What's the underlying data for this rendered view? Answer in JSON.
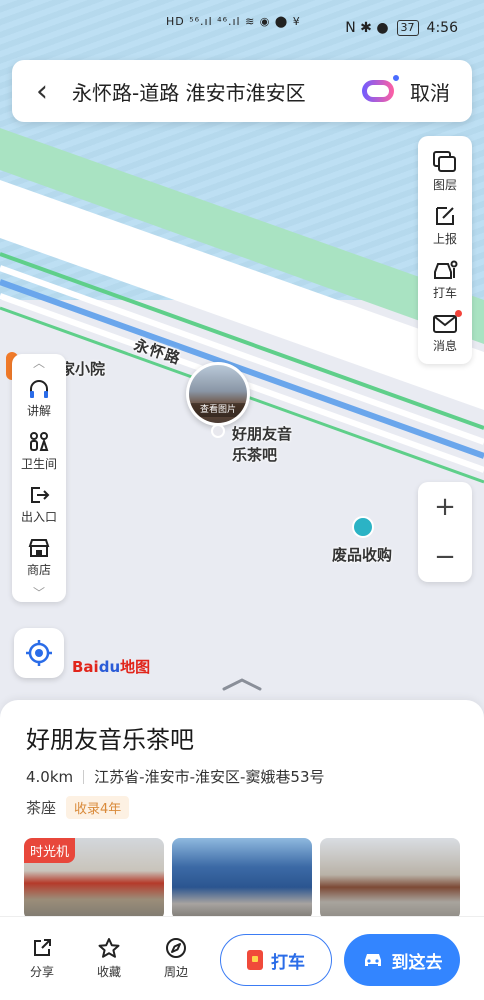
{
  "status_bar": {
    "icons_text": "HD ⁵⁶.ıl ⁴⁶.ıl ≋ ◉ ⬤ ¥",
    "right_icons": "N ✱ ●",
    "battery": "37",
    "time": "4:56"
  },
  "search": {
    "query": "永怀路-道路 淮安市淮安区",
    "cancel_label": "取消"
  },
  "right_toolbar": [
    {
      "icon": "layers-icon",
      "label": "图层"
    },
    {
      "icon": "report-icon",
      "label": "上报"
    },
    {
      "icon": "taxi-icon",
      "label": "打车"
    },
    {
      "icon": "message-icon",
      "label": "消息"
    }
  ],
  "zoom": {
    "in": "+",
    "out": "−"
  },
  "left_toolbar": [
    {
      "icon": "headphones-icon",
      "label": "讲解"
    },
    {
      "icon": "restroom-icon",
      "label": "卫生间"
    },
    {
      "icon": "exit-icon",
      "label": "出入口"
    },
    {
      "icon": "store-icon",
      "label": "商店"
    }
  ],
  "map": {
    "road_label": "永怀路",
    "poi_partial": "家小院",
    "marker_caption": "查看图片",
    "marker_name_line1": "好朋友音",
    "marker_name_line2": "乐茶吧",
    "recycle_label": "废品收购",
    "logo_prefix": "Bai",
    "logo_blue": "du",
    "logo_suffix": "地图"
  },
  "place": {
    "name": "好朋友音乐茶吧",
    "distance": "4.0km",
    "address": "江苏省-淮安市-淮安区-窦娥巷53号",
    "category": "茶座",
    "age_tag": "收录4年",
    "photo_badge": "时光机"
  },
  "actions": {
    "share": "分享",
    "favorite": "收藏",
    "nearby": "周边",
    "taxi": "打车",
    "go": "到这去"
  }
}
